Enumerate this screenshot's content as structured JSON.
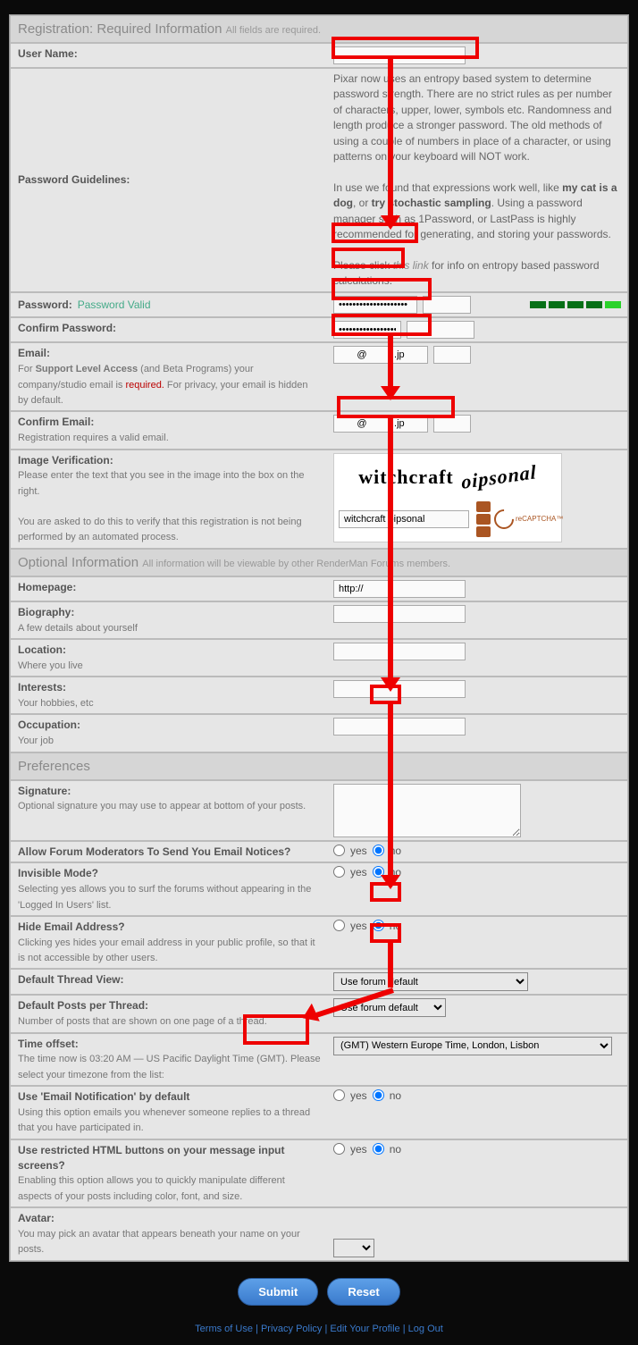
{
  "sections": {
    "required": {
      "title": "Registration: Required Information",
      "sub": "All fields are required."
    },
    "optional": {
      "title": "Optional Information",
      "sub": "All information will be viewable by other RenderMan Forums members."
    },
    "prefs": {
      "title": "Preferences"
    }
  },
  "fields": {
    "username": {
      "label": "User Name:",
      "value": ""
    },
    "pwguidelines": {
      "label": "Password Guidelines:",
      "p1": "Pixar now uses an entropy based system to determine password strength. There are no strict rules as per number of characters, upper, lower, symbols etc. Randomness and length produce a stronger password. The old methods of using a couple of numbers in place of a character, or using patterns on your keyboard will NOT work.",
      "p2a": "In use we found that expressions work well, like ",
      "p2b": "my cat is a dog",
      "p2c": ", or ",
      "p2d": "try stochastic sampling",
      "p2e": ". Using a password manager such as 1Password, or LastPass is highly recommended for generating, and storing your passwords.",
      "p3a": "Please click ",
      "p3link": "this link",
      "p3b": " for info on entropy based password calculations."
    },
    "password": {
      "label": "Password:",
      "valid": "Password Valid",
      "value": "••••••••••••••••••••"
    },
    "confirmpw": {
      "label": "Confirm Password:",
      "value": "••••••••••••••••••"
    },
    "email": {
      "label": "Email:",
      "sub1": "For ",
      "sub1b": "Support Level Access",
      "sub1c": " (and Beta Programs) your company/studio email is ",
      "req": "required.",
      "sub1d": "  For privacy, your email is hidden by default.",
      "value": "@          .jp"
    },
    "confirmemail": {
      "label": "Confirm Email:",
      "sub": "Registration requires a valid email.",
      "value": "@          .jp"
    },
    "captcha": {
      "label": "Image Verification:",
      "sub1": "Please enter the text that you see in the image into the box on the right.",
      "sub2": "You are asked to do this to verify that this registration is not being performed by an automated process.",
      "img1": "witchcraft",
      "img2": "oipsonal",
      "input": "witchcraft oipsonal",
      "brand": "reCAPTCHA™"
    },
    "homepage": {
      "label": "Homepage:",
      "value": "http://"
    },
    "bio": {
      "label": "Biography:",
      "sub": "A few details about yourself"
    },
    "location": {
      "label": "Location:",
      "sub": "Where you live"
    },
    "interests": {
      "label": "Interests:",
      "sub": "Your hobbies, etc"
    },
    "occupation": {
      "label": "Occupation:",
      "sub": "Your job"
    },
    "signature": {
      "label": "Signature:",
      "sub": "Optional signature you may use to appear at bottom of your posts."
    },
    "modemails": {
      "label": "Allow Forum Moderators To Send You Email Notices?"
    },
    "invisible": {
      "label": "Invisible Mode?",
      "sub": "Selecting yes allows you to surf the forums without appearing in the 'Logged In Users' list."
    },
    "hideemail": {
      "label": "Hide Email Address?",
      "sub": "Clicking yes hides your email address in your public profile, so that it is not accessible by other users."
    },
    "threadview": {
      "label": "Default Thread View:",
      "value": "Use forum default"
    },
    "postsper": {
      "label": "Default Posts per Thread:",
      "sub": "Number of posts that are shown on one page of a thread.",
      "value": "Use forum default"
    },
    "timeoffset": {
      "label": "Time offset:",
      "sub": "The time now is 03:20 AM — US Pacific Daylight Time (GMT). Please select your timezone from the list:",
      "value": "(GMT) Western Europe Time, London, Lisbon"
    },
    "emailnotif": {
      "label": "Use 'Email Notification' by default",
      "sub": "Using this option emails you whenever someone replies to a thread that you have participated in."
    },
    "htmlbtns": {
      "label": "Use restricted HTML buttons on your message input screens?",
      "sub": "Enabling this option allows you to quickly manipulate different aspects of your posts including color, font, and size."
    },
    "avatar": {
      "label": "Avatar:",
      "sub": "You may pick an avatar that appears beneath your name on your posts."
    }
  },
  "radio": {
    "yes": "yes",
    "no": "no"
  },
  "buttons": {
    "submit": "Submit",
    "reset": "Reset"
  },
  "footer": {
    "terms": "Terms of Use",
    "privacy": "Privacy Policy",
    "edit": "Edit Your Profile",
    "logout": "Log Out",
    "sep": " | "
  }
}
